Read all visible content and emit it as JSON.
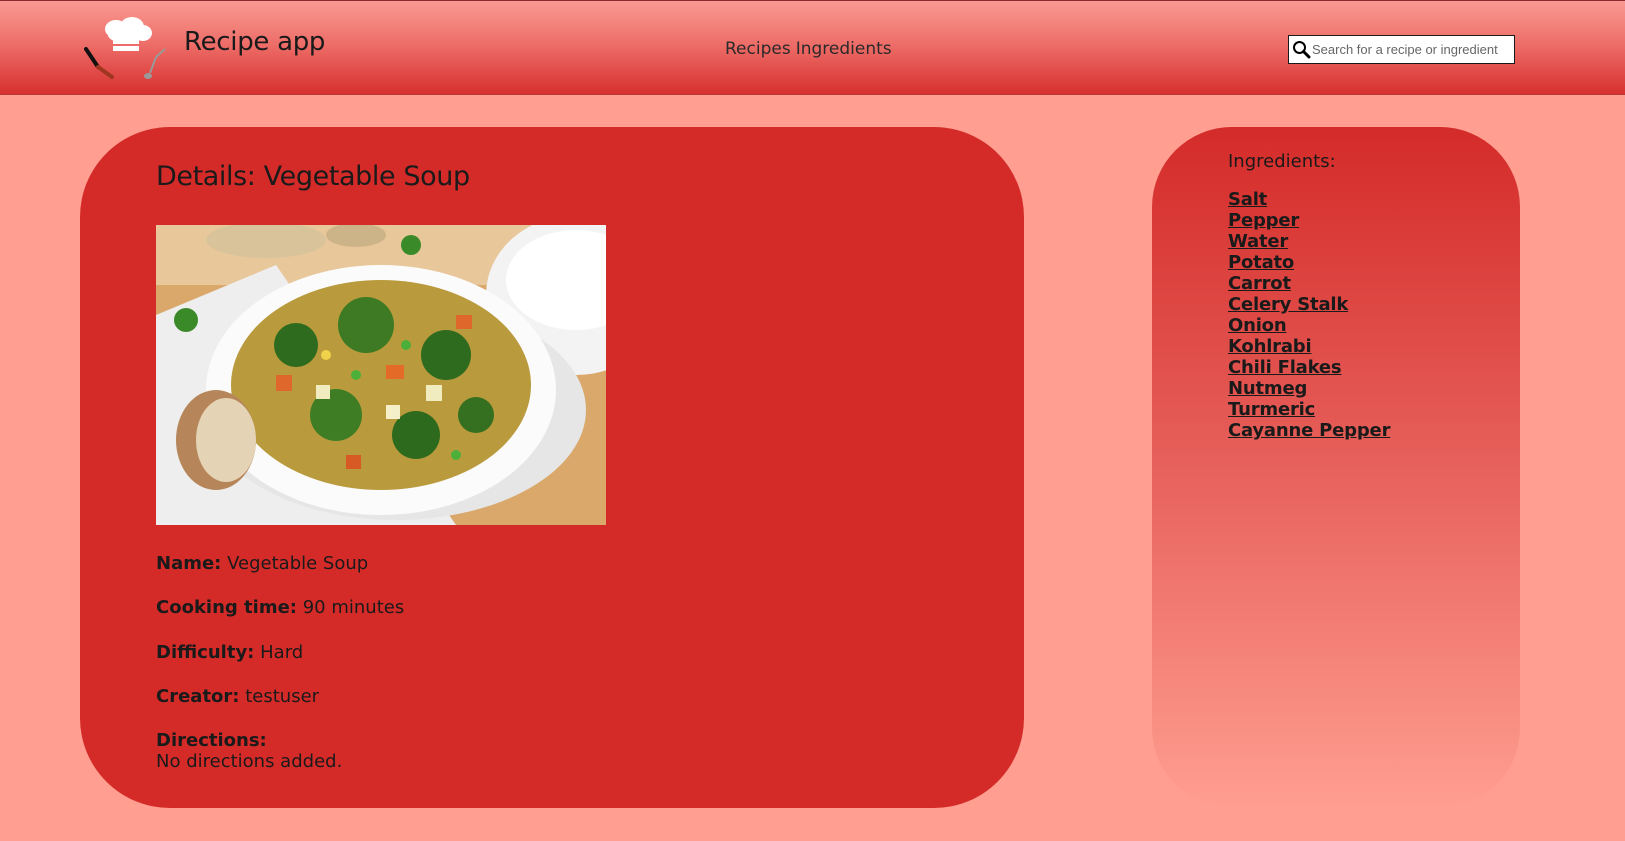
{
  "header": {
    "app_title": "Recipe app",
    "nav_recipes": "Recipes",
    "nav_ingredients": "Ingredients",
    "search_placeholder": "Search for a recipe or ingredient"
  },
  "details": {
    "heading": "Details: Vegetable Soup",
    "name_label": "Name:",
    "name_value": "Vegetable Soup",
    "cooking_time_label": "Cooking time:",
    "cooking_time_value": "90 minutes",
    "difficulty_label": "Difficulty:",
    "difficulty_value": "Hard",
    "creator_label": "Creator:",
    "creator_value": "testuser",
    "directions_label": "Directions:",
    "directions_value": "No directions added."
  },
  "ingredients": {
    "title": "Ingredients:",
    "items": [
      "Salt",
      "Pepper",
      "Water",
      "Potato",
      "Carrot",
      "Celery Stalk",
      "Onion",
      "Kohlrabi",
      "Chili Flakes",
      "Nutmeg",
      "Turmeric",
      "Cayanne Pepper"
    ]
  },
  "colors": {
    "background": "#ff9e91",
    "card": "#d42b29"
  }
}
